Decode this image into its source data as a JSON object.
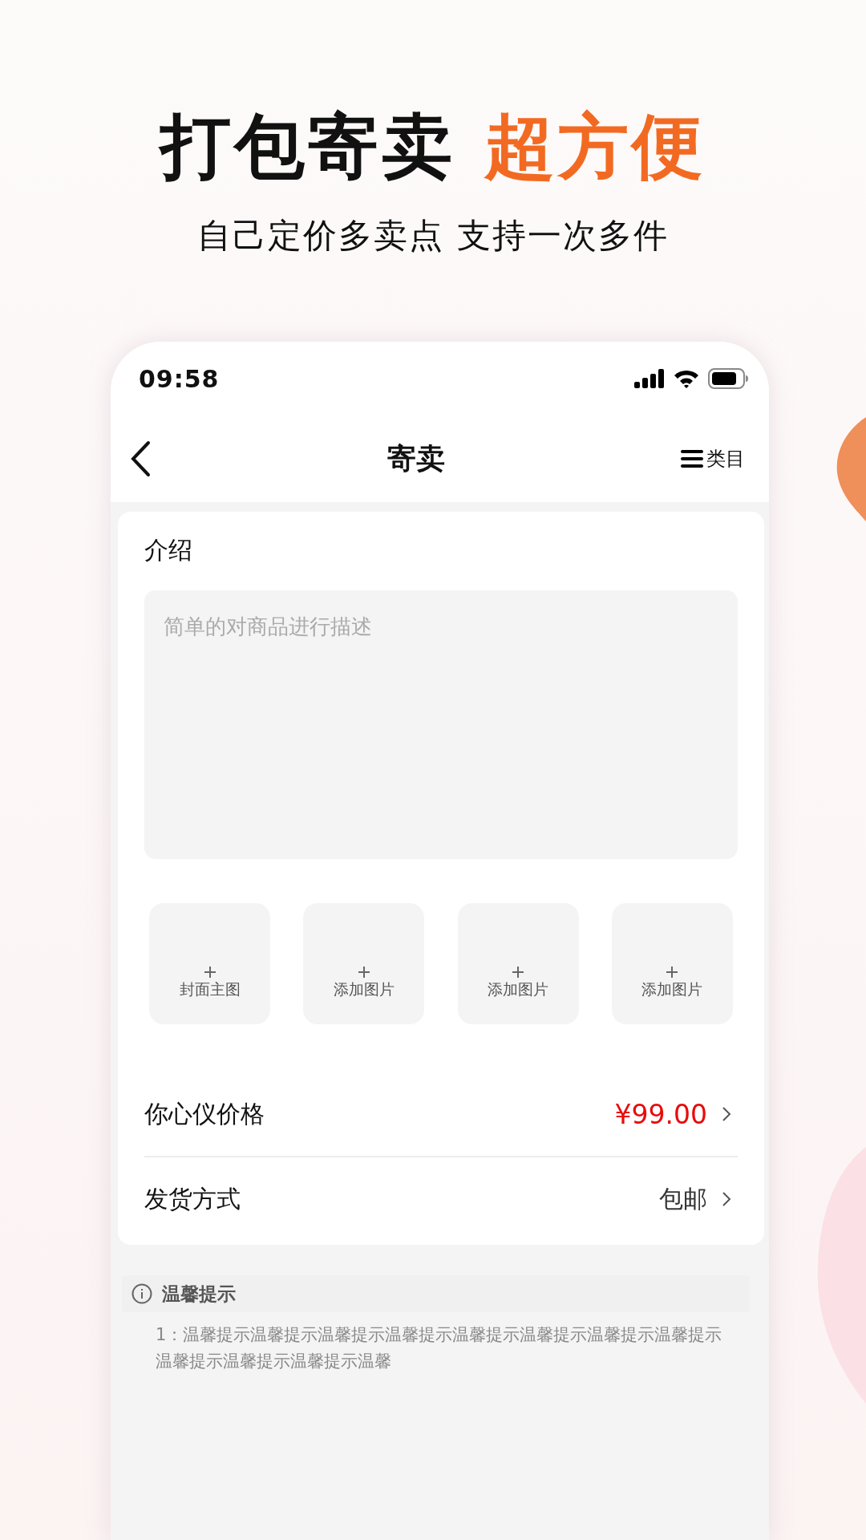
{
  "headline": [
    {
      "text": "打包寄卖",
      "highlight": false
    },
    {
      "text": "超方便",
      "highlight": true
    }
  ],
  "subtitle": "自己定价多卖点 支持一次多件",
  "phone": {
    "status_bar": {
      "time": "09:58"
    },
    "nav": {
      "title": "寄卖",
      "menu_label": "类目"
    },
    "intro": {
      "title": "介绍",
      "placeholder": "简单的对商品进行描述"
    },
    "photo_slots": [
      {
        "label": "封面主图"
      },
      {
        "label": "添加图片"
      },
      {
        "label": "添加图片"
      },
      {
        "label": "添加图片"
      }
    ],
    "rows": [
      {
        "label": "你心仪价格",
        "value": "¥99.00",
        "kind": "price"
      },
      {
        "label": "发货方式",
        "value": "包邮",
        "kind": "plain"
      }
    ],
    "tips": {
      "title": "温馨提示",
      "text": "1：温馨提示温馨提示温馨提示温馨提示温馨提示温馨提示温馨提示温馨提示温馨提示温馨提示温馨提示温馨"
    }
  }
}
